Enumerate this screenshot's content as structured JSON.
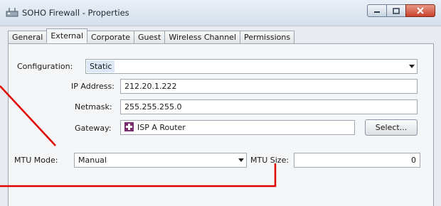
{
  "window": {
    "title": "SOHO Firewall - Properties",
    "icon": "firewall-icon"
  },
  "tabs": [
    {
      "label": "General",
      "active": false
    },
    {
      "label": "External",
      "active": true
    },
    {
      "label": "Corporate",
      "active": false
    },
    {
      "label": "Guest",
      "active": false
    },
    {
      "label": "Wireless Channel",
      "active": false
    },
    {
      "label": "Permissions",
      "active": false
    }
  ],
  "form": {
    "configuration_label": "Configuration:",
    "configuration_value": "Static",
    "ip_label": "IP Address:",
    "ip_value": "212.20.1.222",
    "netmask_label": "Netmask:",
    "netmask_value": "255.255.255.0",
    "gateway_label": "Gateway:",
    "gateway_value": "ISP A  Router",
    "gateway_icon": "router-icon",
    "select_button": "Select...",
    "mtu_mode_label": "MTU Mode:",
    "mtu_mode_value": "Manual",
    "mtu_size_label": "MTU Size:",
    "mtu_size_value": "0"
  },
  "colors": {
    "annotation_line": "#e00000",
    "titlebar": "#d4dfeb",
    "close_button": "#c9432c"
  }
}
